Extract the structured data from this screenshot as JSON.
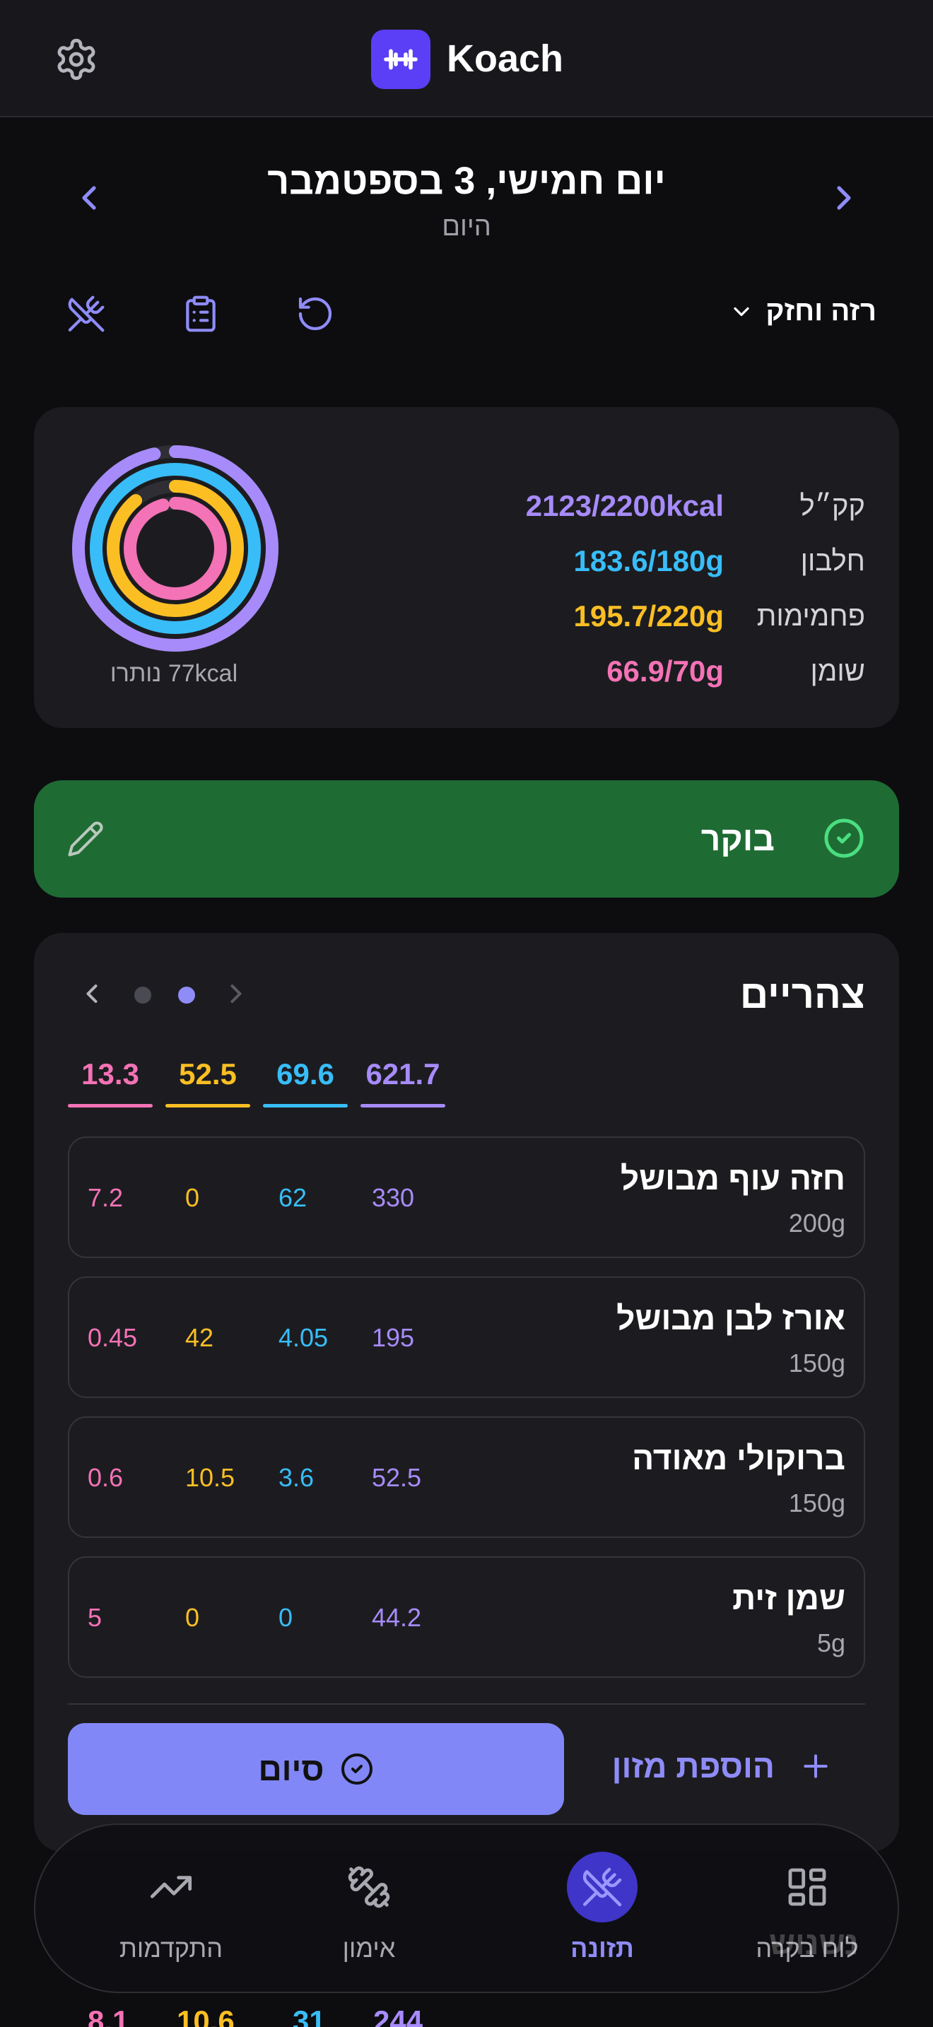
{
  "app": {
    "title": "Koach"
  },
  "date_nav": {
    "title": "יום חמישי, 3 בספטמבר",
    "subtitle": "היום"
  },
  "plan": {
    "name": "רזה וחזק"
  },
  "summary": {
    "rows": [
      {
        "label": "קק״ל",
        "value": "2123/2200kcal",
        "color": "#a78bfa"
      },
      {
        "label": "חלבון",
        "value": "183.6/180g",
        "color": "#38bdf8"
      },
      {
        "label": "פחמימות",
        "value": "195.7/220g",
        "color": "#fbbf24"
      },
      {
        "label": "שומן",
        "value": "66.9/70g",
        "color": "#f472b6"
      }
    ],
    "remaining": "77kcal נותרו"
  },
  "breakfast": {
    "label": "בוקר"
  },
  "lunch": {
    "title": "צהריים",
    "totals": {
      "kcal": "621.7",
      "protein": "69.6",
      "carbs": "52.5",
      "fat": "13.3"
    },
    "foods": [
      {
        "name": "חזה עוף מבושל",
        "grams": "200g",
        "kcal": "330",
        "protein": "62",
        "carbs": "0",
        "fat": "7.2"
      },
      {
        "name": "אורז לבן מבושל",
        "grams": "150g",
        "kcal": "195",
        "protein": "4.05",
        "carbs": "42",
        "fat": "0.45"
      },
      {
        "name": "ברוקולי מאודה",
        "grams": "150g",
        "kcal": "52.5",
        "protein": "3.6",
        "carbs": "10.5",
        "fat": "0.6"
      },
      {
        "name": "שמן זית",
        "grams": "5g",
        "kcal": "44.2",
        "protein": "0",
        "carbs": "0",
        "fat": "5"
      }
    ],
    "finish_label": "סיום",
    "add_food_label": "הוספת מזון"
  },
  "peek": {
    "kcal": "244",
    "protein": "31",
    "carbs": "10.6",
    "fat": "8.1",
    "dinner_partial": "נשנוש"
  },
  "nav": {
    "dashboard": "לוח בקרה",
    "nutrition": "תזונה",
    "workout": "אימון",
    "progress": "התקדמות"
  },
  "colors": {
    "kcal": "#a78bfa",
    "protein": "#38bdf8",
    "carbs": "#fbbf24",
    "fat": "#f472b6",
    "accent": "#5b3ff6",
    "done_green": "#1f6b34"
  },
  "progress": {
    "kcal": 0.965,
    "protein": 1.0,
    "carbs": 0.89,
    "fat": 0.956
  }
}
